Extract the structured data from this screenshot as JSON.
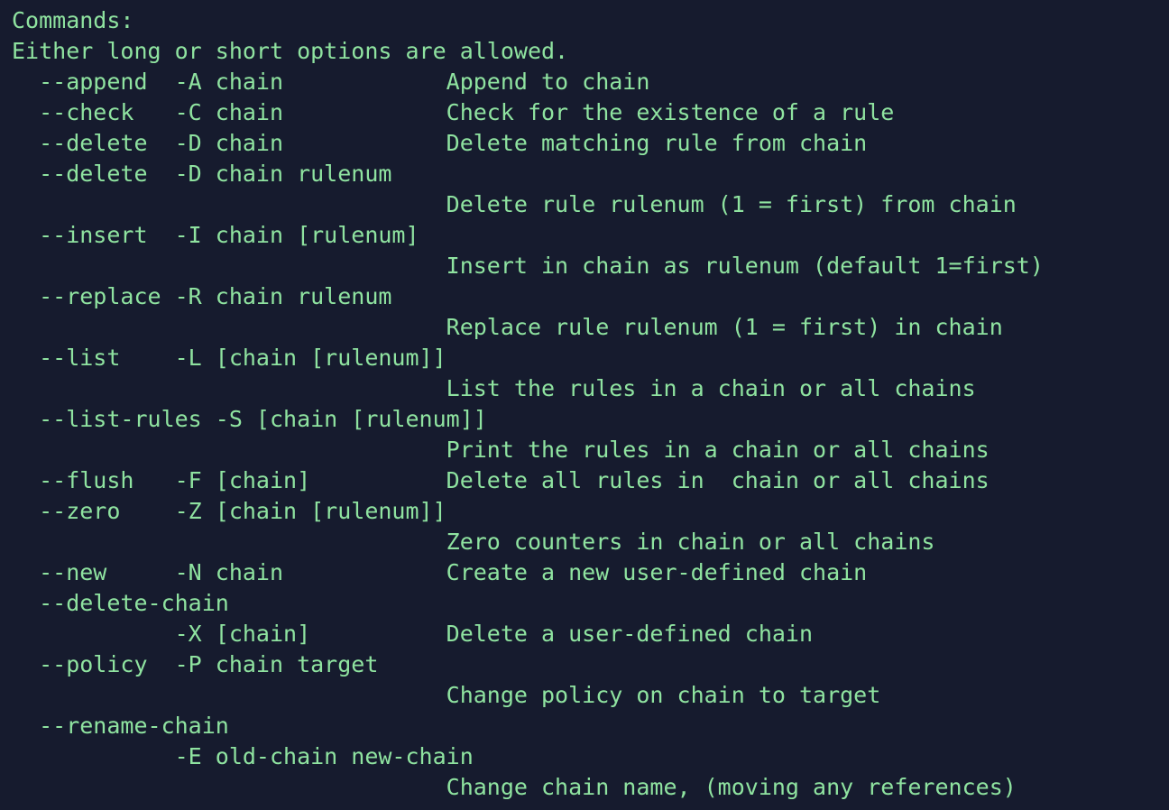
{
  "terminal": {
    "lines": [
      "Commands:",
      "Either long or short options are allowed.",
      "  --append  -A chain            Append to chain",
      "  --check   -C chain            Check for the existence of a rule",
      "  --delete  -D chain            Delete matching rule from chain",
      "  --delete  -D chain rulenum",
      "                                Delete rule rulenum (1 = first) from chain",
      "  --insert  -I chain [rulenum]",
      "                                Insert in chain as rulenum (default 1=first)",
      "  --replace -R chain rulenum",
      "                                Replace rule rulenum (1 = first) in chain",
      "  --list    -L [chain [rulenum]]",
      "                                List the rules in a chain or all chains",
      "  --list-rules -S [chain [rulenum]]",
      "                                Print the rules in a chain or all chains",
      "  --flush   -F [chain]          Delete all rules in  chain or all chains",
      "  --zero    -Z [chain [rulenum]]",
      "                                Zero counters in chain or all chains",
      "  --new     -N chain            Create a new user-defined chain",
      "  --delete-chain",
      "            -X [chain]          Delete a user-defined chain",
      "  --policy  -P chain target",
      "                                Change policy on chain to target",
      "  --rename-chain",
      "            -E old-chain new-chain",
      "                                Change chain name, (moving any references)"
    ],
    "colors": {
      "background": "#161b2e",
      "text": "#8fe3a0"
    }
  }
}
